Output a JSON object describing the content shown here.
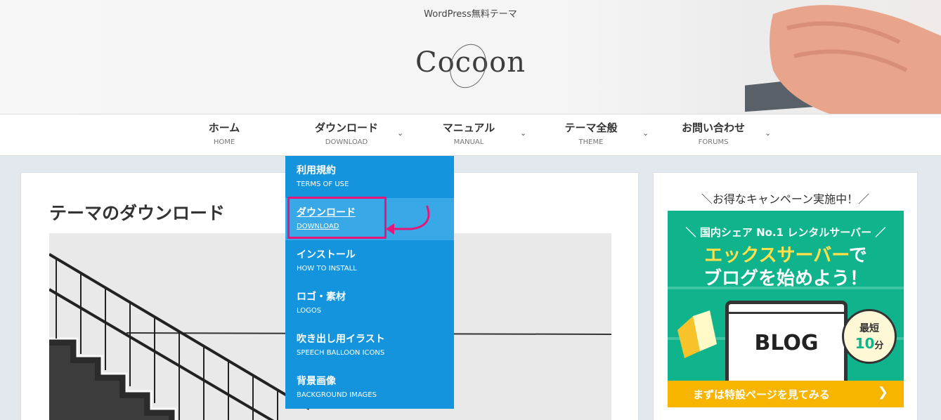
{
  "header": {
    "tagline": "WordPress無料テーマ",
    "logo": "Cocoon"
  },
  "nav": {
    "items": [
      {
        "label": "ホーム",
        "sub": "HOME"
      },
      {
        "label": "ダウンロード",
        "sub": "DOWNLOAD"
      },
      {
        "label": "マニュアル",
        "sub": "MANUAL"
      },
      {
        "label": "テーマ全般",
        "sub": "THEME"
      },
      {
        "label": "お問い合わせ",
        "sub": "FORUMS"
      }
    ],
    "caret": "⌄"
  },
  "dropdown": {
    "items": [
      {
        "label": "利用規約",
        "sub": "TERMS OF USE"
      },
      {
        "label": "ダウンロード",
        "sub": "DOWNLOAD"
      },
      {
        "label": "インストール",
        "sub": "HOW TO INSTALL"
      },
      {
        "label": "ロゴ・素材",
        "sub": "LOGOS"
      },
      {
        "label": "吹き出し用イラスト",
        "sub": "SPEECH BALLOON ICONS"
      },
      {
        "label": "背景画像",
        "sub": "BACKGROUND IMAGES"
      }
    ],
    "active_index": 1
  },
  "main": {
    "title": "テーマのダウンロード"
  },
  "sidebar": {
    "title": "＼お得なキャンペーン実施中！／",
    "banner": {
      "top_line": "＼ 国内シェア No.1 レンタルサーバー ／",
      "brand": "エックスサーバー",
      "brand_suffix": "で",
      "line2": "ブログを始めよう！",
      "screen_text": "BLOG",
      "bubble_top": "最短",
      "bubble_num": "10",
      "bubble_unit": "分",
      "cta": "まずは特設ページを見てみる",
      "cta_icon": "chevron-right-icon"
    }
  },
  "colors": {
    "dropdown_bg": "#1494dc",
    "dropdown_active": "#38a9e6",
    "highlight": "#e5177a",
    "banner_green": "#0fb48d",
    "cta_yellow": "#f7b500"
  }
}
